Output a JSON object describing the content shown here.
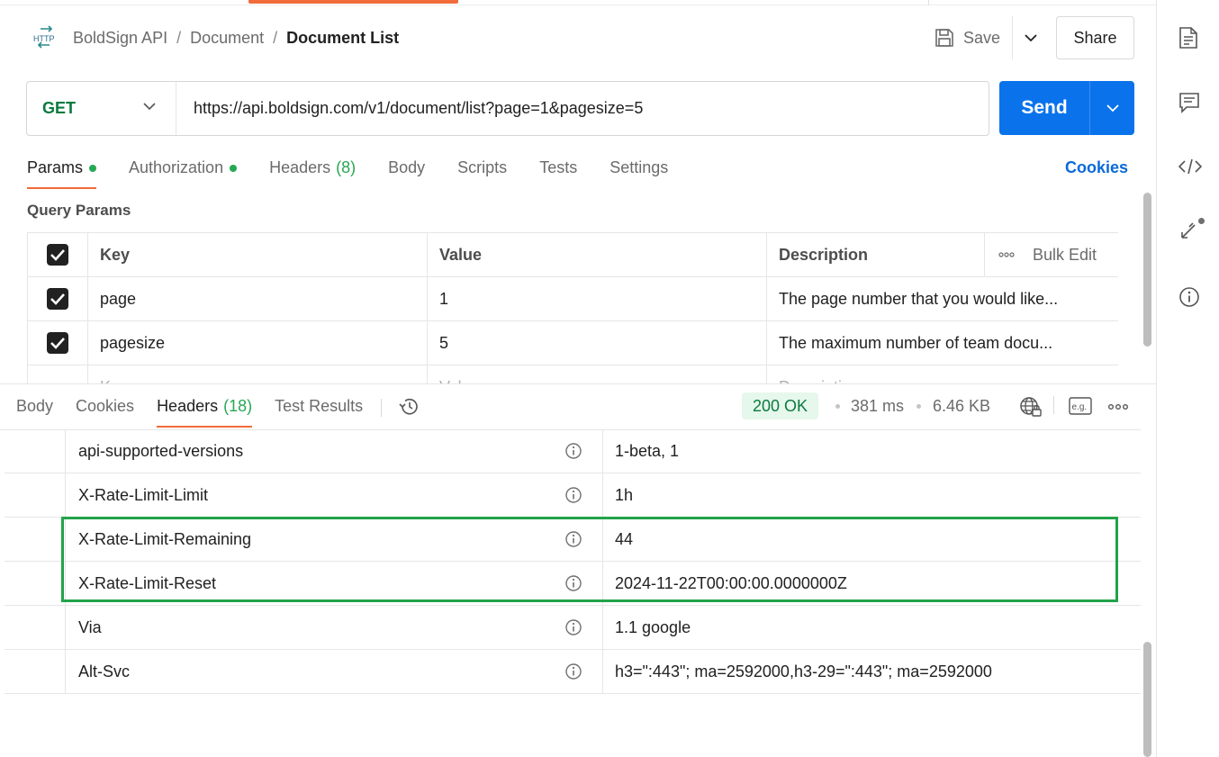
{
  "breadcrumb": {
    "items": [
      "BoldSign API",
      "Document"
    ],
    "current": "Document List",
    "separator": "/"
  },
  "http_icon": {
    "name": "http-request-icon",
    "text": "HTTP"
  },
  "toolbar": {
    "save_label": "Save",
    "share_label": "Share"
  },
  "request": {
    "method": "GET",
    "url": "https://api.boldsign.com/v1/document/list?page=1&pagesize=5",
    "send_label": "Send"
  },
  "request_tabs": {
    "params": "Params",
    "authorization": "Authorization",
    "headers": "Headers",
    "headers_count": "(8)",
    "body": "Body",
    "scripts": "Scripts",
    "tests": "Tests",
    "settings": "Settings",
    "cookies_link": "Cookies"
  },
  "query_params": {
    "title": "Query Params",
    "columns": {
      "key": "Key",
      "value": "Value",
      "description": "Description",
      "bulk_edit": "Bulk Edit"
    },
    "rows": [
      {
        "key": "page",
        "value": "1",
        "description": "The page number that you would like..."
      },
      {
        "key": "pagesize",
        "value": "5",
        "description": "The maximum number of team docu..."
      }
    ],
    "placeholder_row": {
      "key": "Key",
      "value": "Value",
      "description": "Description"
    }
  },
  "response_tabs": {
    "body": "Body",
    "cookies": "Cookies",
    "headers": "Headers",
    "headers_count": "(18)",
    "test_results": "Test Results"
  },
  "response_meta": {
    "status": "200 OK",
    "time": "381 ms",
    "size": "6.46 KB",
    "example_label": "e.g."
  },
  "response_headers": [
    {
      "key": "api-supported-versions",
      "value": "1-beta, 1"
    },
    {
      "key": "X-Rate-Limit-Limit",
      "value": "1h"
    },
    {
      "key": "X-Rate-Limit-Remaining",
      "value": "44"
    },
    {
      "key": "X-Rate-Limit-Reset",
      "value": "2024-11-22T00:00:00.0000000Z"
    },
    {
      "key": "Via",
      "value": "1.1 google"
    },
    {
      "key": "Alt-Svc",
      "value": "h3=\":443\"; ma=2592000,h3-29=\":443\"; ma=2592000"
    }
  ],
  "colors": {
    "accent_orange": "#f26b3a",
    "send_blue": "#0a73eb",
    "success_green": "#27a853",
    "method_green": "#0b7a3e",
    "highlight_green": "#22a34a"
  }
}
